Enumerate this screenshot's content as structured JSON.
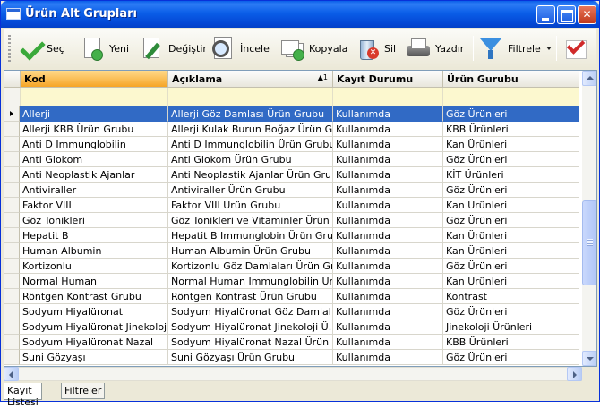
{
  "window": {
    "title": "Ürün Alt Grupları"
  },
  "toolbar": {
    "select": {
      "label": "Seç",
      "icon": "checkmark-icon"
    },
    "new": {
      "label": "Yeni",
      "icon": "new-document-icon"
    },
    "edit": {
      "label": "Değiştir",
      "icon": "edit-document-icon"
    },
    "inspect": {
      "label": "İncele",
      "icon": "magnifier-icon"
    },
    "copy": {
      "label": "Kopyala",
      "icon": "copy-icon"
    },
    "delete": {
      "label": "Sil",
      "icon": "trash-icon"
    },
    "print": {
      "label": "Yazdır",
      "icon": "printer-icon"
    },
    "filter": {
      "label": "Filtrele",
      "icon": "filter-funnel-icon"
    }
  },
  "grid": {
    "columns": [
      "Kod",
      "Açıklama",
      "Kayıt Durumu",
      "Ürün Gurubu"
    ],
    "sort_indicator": "▲1",
    "rows": [
      [
        "Allerji",
        "Allerji Göz Damlası Ürün Grubu",
        "Kullanımda",
        "Göz Ürünleri"
      ],
      [
        "Allerji KBB Ürün Grubu",
        "Allerji Kulak Burun Boğaz Ürün Grubu",
        "Kullanımda",
        "KBB Ürünleri"
      ],
      [
        "Anti D Immunglobilin",
        "Anti D Immunglobilin Ürün Grubu",
        "Kullanımda",
        "Kan Ürünleri"
      ],
      [
        "Anti Glokom",
        "Anti Glokom  Ürün Grubu",
        "Kullanımda",
        "Göz Ürünleri"
      ],
      [
        "Anti Neoplastik Ajanlar",
        "Anti Neoplastik Ajanlar Ürün Grubu",
        "Kullanımda",
        "KİT Ürünleri"
      ],
      [
        "Antiviraller",
        "Antiviraller Ürün Grubu",
        "Kullanımda",
        "Göz Ürünleri"
      ],
      [
        "Faktor VIII",
        "Faktor VIII  Ürün Grubu",
        "Kullanımda",
        "Kan Ürünleri"
      ],
      [
        "Göz Tonikleri",
        "Göz Tonikleri ve Vitaminler Ürün ...",
        "Kullanımda",
        "Göz Ürünleri"
      ],
      [
        "Hepatit B",
        "Hepatit B Immunglobin Ürün Grubu",
        "Kullanımda",
        "Kan Ürünleri"
      ],
      [
        "Human Albumin",
        "Human Albumin Ürün Grubu",
        "Kullanımda",
        "Kan Ürünleri"
      ],
      [
        "Kortizonlu",
        "Kortizonlu Göz Damlaları Ürün Grubu",
        "Kullanımda",
        "Göz Ürünleri"
      ],
      [
        "Normal Human",
        "Normal Human Immunglobilin Ür...",
        "Kullanımda",
        "Kan Ürünleri"
      ],
      [
        "Röntgen Kontrast Grubu",
        "Röntgen Kontrast Ürün Grubu",
        "Kullanımda",
        "Kontrast"
      ],
      [
        "Sodyum Hiyalüronat",
        "Sodyum Hiyalüronat Göz Damlal...",
        "Kullanımda",
        "Göz Ürünleri"
      ],
      [
        "Sodyum Hiyalüronat Jinekoloji",
        "Sodyum Hiyalüronat Jinekoloji Ü...",
        "Kullanımda",
        "Jinekoloji Ürünleri"
      ],
      [
        "Sodyum Hiyalüronat Nazal",
        "Sodyum Hiyalüronat Nazal Ürün ...",
        "Kullanımda",
        "KBB Ürünleri"
      ],
      [
        "Suni Gözyaşı",
        "Suni Gözyaşı Ürün Grubu",
        "Kullanımda",
        "Göz Ürünleri"
      ]
    ]
  },
  "tabs": [
    "Kayıt Listesi",
    "Filtreler"
  ],
  "colors": {
    "selection": "#316ac5",
    "sorted_header": "#f6a526",
    "filter_row": "#fcf8cf"
  }
}
